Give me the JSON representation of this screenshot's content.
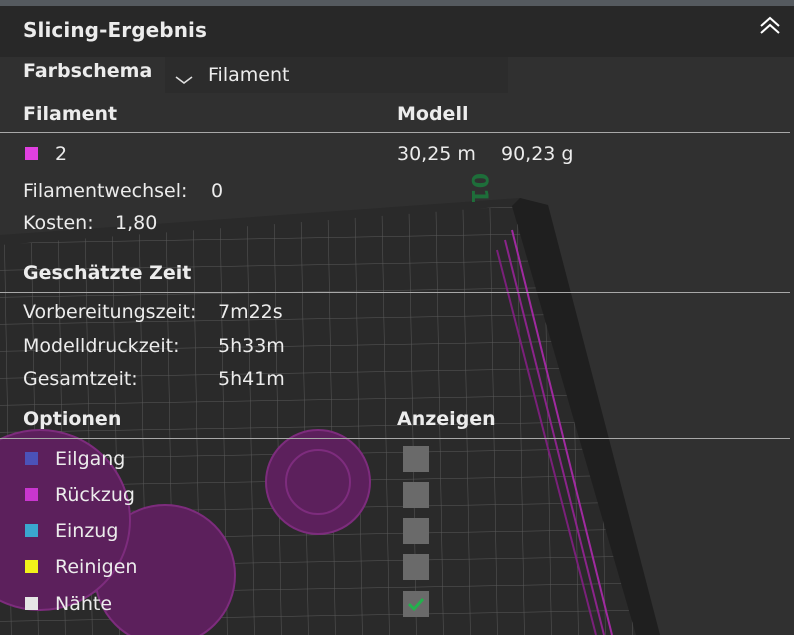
{
  "header": {
    "title": "Slicing-Ergebnis"
  },
  "color_scheme": {
    "label": "Farbschema",
    "selected": "Filament"
  },
  "filament_table": {
    "col_left": "Filament",
    "col_right": "Modell",
    "row": {
      "name": "2",
      "color": "#e040e0",
      "length": "30,25 m",
      "weight": "90,23 g"
    },
    "changes_label": "Filamentwechsel:",
    "changes_value": "0",
    "cost_label": "Kosten:",
    "cost_value": "1,80"
  },
  "time": {
    "heading": "Geschätzte Zeit",
    "rows": [
      {
        "label": "Vorbereitungszeit:",
        "value": "7m22s"
      },
      {
        "label": "Modelldruckzeit:",
        "value": "5h33m"
      },
      {
        "label": "Gesamtzeit:",
        "value": "5h41m"
      }
    ]
  },
  "options": {
    "col_left": "Optionen",
    "col_right": "Anzeigen",
    "items": [
      {
        "label": "Eilgang",
        "color": "#4b52b8",
        "checked": false
      },
      {
        "label": "Rückzug",
        "color": "#c936cf",
        "checked": false
      },
      {
        "label": "Einzug",
        "color": "#3aa7cf",
        "checked": false
      },
      {
        "label": "Reinigen",
        "color": "#f2f21a",
        "checked": false
      },
      {
        "label": "Nähte",
        "color": "#e6e6e6",
        "checked": true
      }
    ]
  },
  "colors": {
    "check": "#22b14c",
    "separator": "#a8a8a8"
  }
}
